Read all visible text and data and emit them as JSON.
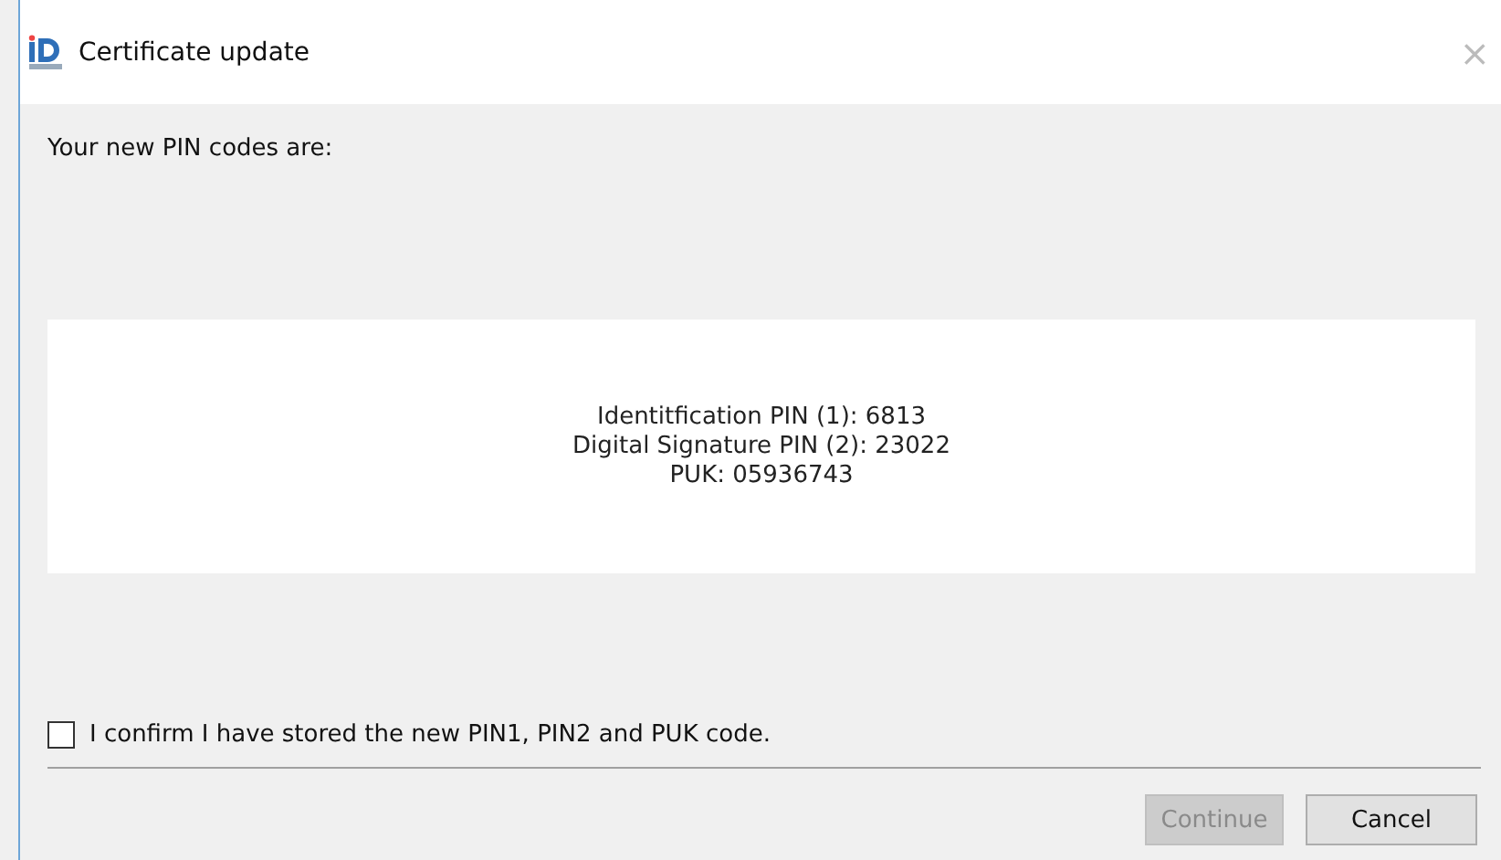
{
  "window": {
    "title": "Certificate update",
    "close": "×"
  },
  "intro": "Your new PIN codes are:",
  "codes": [
    "Identitfication PIN (1): 6813",
    "Digital Signature PIN (2): 23022",
    "PUK: 05936743"
  ],
  "confirm": {
    "label": "I confirm I have stored the new PIN1, PIN2 and PUK code.",
    "checked": false
  },
  "buttons": [
    {
      "label": "Continue",
      "disabled": true
    },
    {
      "label": "Cancel",
      "disabled": false
    }
  ]
}
